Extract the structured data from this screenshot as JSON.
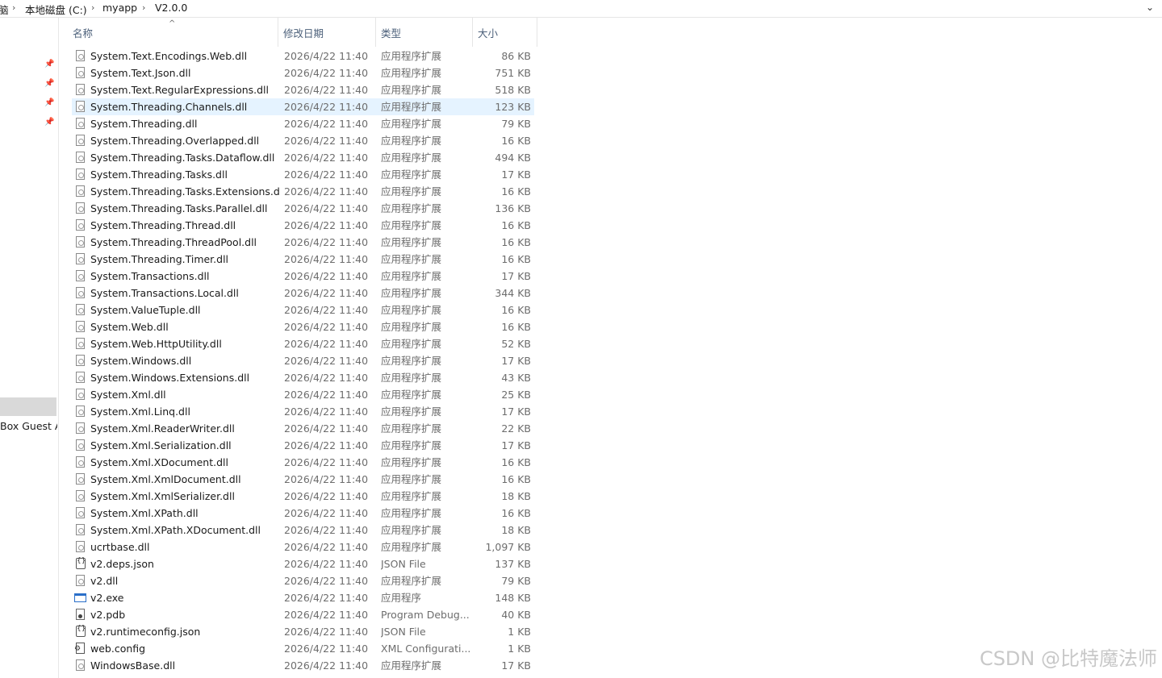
{
  "breadcrumb": {
    "items": [
      "脑",
      "本地磁盘 (C:)",
      "myapp",
      "V2.0.0"
    ],
    "separator": "›",
    "dropdown_icon": "chevron-down-icon"
  },
  "nav": {
    "pin_icon": "pin-icon",
    "guest_label": "Box Guest A"
  },
  "columns": {
    "name": "名称",
    "date": "修改日期",
    "type": "类型",
    "size": "大小",
    "sort_indicator": "^"
  },
  "files": [
    {
      "name": "System.Text.Encodings.Web.dll",
      "date": "2026/4/22 11:40",
      "type": "应用程序扩展",
      "size": "86 KB",
      "icon": "dll"
    },
    {
      "name": "System.Text.Json.dll",
      "date": "2026/4/22 11:40",
      "type": "应用程序扩展",
      "size": "751 KB",
      "icon": "dll"
    },
    {
      "name": "System.Text.RegularExpressions.dll",
      "date": "2026/4/22 11:40",
      "type": "应用程序扩展",
      "size": "518 KB",
      "icon": "dll"
    },
    {
      "name": "System.Threading.Channels.dll",
      "date": "2026/4/22 11:40",
      "type": "应用程序扩展",
      "size": "123 KB",
      "icon": "dll",
      "selected": true
    },
    {
      "name": "System.Threading.dll",
      "date": "2026/4/22 11:40",
      "type": "应用程序扩展",
      "size": "79 KB",
      "icon": "dll"
    },
    {
      "name": "System.Threading.Overlapped.dll",
      "date": "2026/4/22 11:40",
      "type": "应用程序扩展",
      "size": "16 KB",
      "icon": "dll"
    },
    {
      "name": "System.Threading.Tasks.Dataflow.dll",
      "date": "2026/4/22 11:40",
      "type": "应用程序扩展",
      "size": "494 KB",
      "icon": "dll"
    },
    {
      "name": "System.Threading.Tasks.dll",
      "date": "2026/4/22 11:40",
      "type": "应用程序扩展",
      "size": "17 KB",
      "icon": "dll"
    },
    {
      "name": "System.Threading.Tasks.Extensions.dll",
      "date": "2026/4/22 11:40",
      "type": "应用程序扩展",
      "size": "16 KB",
      "icon": "dll"
    },
    {
      "name": "System.Threading.Tasks.Parallel.dll",
      "date": "2026/4/22 11:40",
      "type": "应用程序扩展",
      "size": "136 KB",
      "icon": "dll"
    },
    {
      "name": "System.Threading.Thread.dll",
      "date": "2026/4/22 11:40",
      "type": "应用程序扩展",
      "size": "16 KB",
      "icon": "dll"
    },
    {
      "name": "System.Threading.ThreadPool.dll",
      "date": "2026/4/22 11:40",
      "type": "应用程序扩展",
      "size": "16 KB",
      "icon": "dll"
    },
    {
      "name": "System.Threading.Timer.dll",
      "date": "2026/4/22 11:40",
      "type": "应用程序扩展",
      "size": "16 KB",
      "icon": "dll"
    },
    {
      "name": "System.Transactions.dll",
      "date": "2026/4/22 11:40",
      "type": "应用程序扩展",
      "size": "17 KB",
      "icon": "dll"
    },
    {
      "name": "System.Transactions.Local.dll",
      "date": "2026/4/22 11:40",
      "type": "应用程序扩展",
      "size": "344 KB",
      "icon": "dll"
    },
    {
      "name": "System.ValueTuple.dll",
      "date": "2026/4/22 11:40",
      "type": "应用程序扩展",
      "size": "16 KB",
      "icon": "dll"
    },
    {
      "name": "System.Web.dll",
      "date": "2026/4/22 11:40",
      "type": "应用程序扩展",
      "size": "16 KB",
      "icon": "dll"
    },
    {
      "name": "System.Web.HttpUtility.dll",
      "date": "2026/4/22 11:40",
      "type": "应用程序扩展",
      "size": "52 KB",
      "icon": "dll"
    },
    {
      "name": "System.Windows.dll",
      "date": "2026/4/22 11:40",
      "type": "应用程序扩展",
      "size": "17 KB",
      "icon": "dll"
    },
    {
      "name": "System.Windows.Extensions.dll",
      "date": "2026/4/22 11:40",
      "type": "应用程序扩展",
      "size": "43 KB",
      "icon": "dll"
    },
    {
      "name": "System.Xml.dll",
      "date": "2026/4/22 11:40",
      "type": "应用程序扩展",
      "size": "25 KB",
      "icon": "dll"
    },
    {
      "name": "System.Xml.Linq.dll",
      "date": "2026/4/22 11:40",
      "type": "应用程序扩展",
      "size": "17 KB",
      "icon": "dll"
    },
    {
      "name": "System.Xml.ReaderWriter.dll",
      "date": "2026/4/22 11:40",
      "type": "应用程序扩展",
      "size": "22 KB",
      "icon": "dll"
    },
    {
      "name": "System.Xml.Serialization.dll",
      "date": "2026/4/22 11:40",
      "type": "应用程序扩展",
      "size": "17 KB",
      "icon": "dll"
    },
    {
      "name": "System.Xml.XDocument.dll",
      "date": "2026/4/22 11:40",
      "type": "应用程序扩展",
      "size": "16 KB",
      "icon": "dll"
    },
    {
      "name": "System.Xml.XmlDocument.dll",
      "date": "2026/4/22 11:40",
      "type": "应用程序扩展",
      "size": "16 KB",
      "icon": "dll"
    },
    {
      "name": "System.Xml.XmlSerializer.dll",
      "date": "2026/4/22 11:40",
      "type": "应用程序扩展",
      "size": "18 KB",
      "icon": "dll"
    },
    {
      "name": "System.Xml.XPath.dll",
      "date": "2026/4/22 11:40",
      "type": "应用程序扩展",
      "size": "16 KB",
      "icon": "dll"
    },
    {
      "name": "System.Xml.XPath.XDocument.dll",
      "date": "2026/4/22 11:40",
      "type": "应用程序扩展",
      "size": "18 KB",
      "icon": "dll"
    },
    {
      "name": "ucrtbase.dll",
      "date": "2026/4/22 11:40",
      "type": "应用程序扩展",
      "size": "1,097 KB",
      "icon": "dll"
    },
    {
      "name": "v2.deps.json",
      "date": "2026/4/22 11:40",
      "type": "JSON File",
      "size": "137 KB",
      "icon": "json"
    },
    {
      "name": "v2.dll",
      "date": "2026/4/22 11:40",
      "type": "应用程序扩展",
      "size": "79 KB",
      "icon": "dll"
    },
    {
      "name": "v2.exe",
      "date": "2026/4/22 11:40",
      "type": "应用程序",
      "size": "148 KB",
      "icon": "exe"
    },
    {
      "name": "v2.pdb",
      "date": "2026/4/22 11:40",
      "type": "Program Debug...",
      "size": "40 KB",
      "icon": "pdb"
    },
    {
      "name": "v2.runtimeconfig.json",
      "date": "2026/4/22 11:40",
      "type": "JSON File",
      "size": "1 KB",
      "icon": "json"
    },
    {
      "name": "web.config",
      "date": "2026/4/22 11:40",
      "type": "XML Configurati...",
      "size": "1 KB",
      "icon": "cfg"
    },
    {
      "name": "WindowsBase.dll",
      "date": "2026/4/22 11:40",
      "type": "应用程序扩展",
      "size": "17 KB",
      "icon": "dll"
    }
  ],
  "watermark": "CSDN @比特魔法师"
}
